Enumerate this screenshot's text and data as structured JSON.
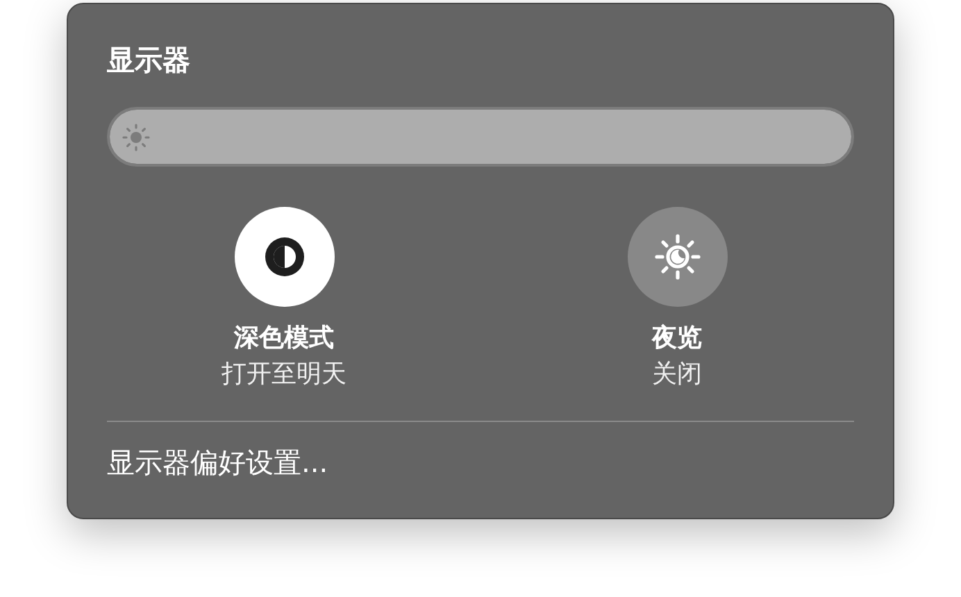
{
  "title": "显示器",
  "brightness": {
    "level": 1
  },
  "toggles": [
    {
      "kind": "dark-mode",
      "label": "深色模式",
      "status": "打开至明天",
      "on": true
    },
    {
      "kind": "night-shift",
      "label": "夜览",
      "status": "关闭",
      "on": false
    }
  ],
  "footer_link": "显示器偏好设置..."
}
